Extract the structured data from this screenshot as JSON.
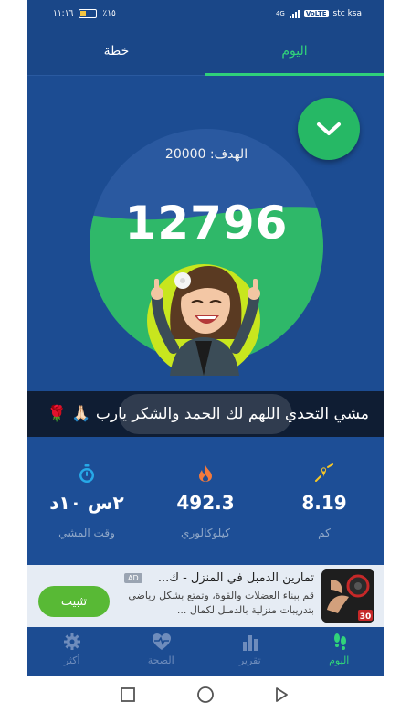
{
  "status_bar": {
    "time": "١١:١٦",
    "battery": "٪١٥",
    "carrier": "stc ksa",
    "network": "4G"
  },
  "tabs": [
    {
      "label": "خطة",
      "active": false
    },
    {
      "label": "اليوم",
      "active": true
    }
  ],
  "goal": {
    "label": "الهدف: 20000",
    "value": 20000
  },
  "steps": "12796",
  "progress": 0.64,
  "banner": {
    "text": "مشي التحدي اللهم لك الحمد والشكر يارب 🙏🏻 🌹"
  },
  "stats": {
    "distance": {
      "value": "8.19",
      "label": "كم",
      "icon": "location-pin-icon"
    },
    "calories": {
      "value": "492.3",
      "label": "كيلوكالوري",
      "icon": "flame-icon"
    },
    "time": {
      "value": "٢س ١٠د",
      "label": "وقت المشي",
      "icon": "stopwatch-icon"
    }
  },
  "ad": {
    "badge": "AD",
    "title": "تمارين الدمبل في المنزل - ك...",
    "body": "قم ببناء العضلات والقوة، وتمتع بشكل رياضي بتدريبات منزلية بالدمبل لكمال ...",
    "install": "تثبيت",
    "thumb_number": "30"
  },
  "bottom_nav": [
    {
      "label": "اليوم",
      "icon": "footprints-icon",
      "active": true
    },
    {
      "label": "تقرير",
      "icon": "bar-chart-icon",
      "active": false
    },
    {
      "label": "الصحة",
      "icon": "heart-pulse-icon",
      "active": false
    },
    {
      "label": "أكثر",
      "icon": "gear-icon",
      "active": false
    }
  ],
  "colors": {
    "background": "#1c4c92",
    "accent_green": "#2fd17a",
    "progress_green": "#2fb869",
    "ad_button": "#58b935"
  }
}
